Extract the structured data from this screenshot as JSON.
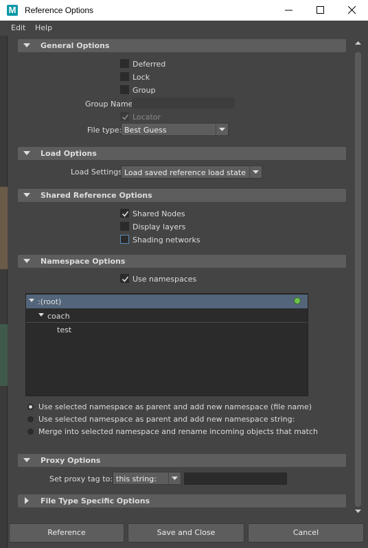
{
  "window": {
    "title": "Reference Options",
    "app_icon_letter": "M"
  },
  "menu": {
    "items": [
      "Edit",
      "Help"
    ]
  },
  "general": {
    "title": "General Options",
    "deferred": "Deferred",
    "lock": "Lock",
    "group": "Group",
    "group_name_label": "Group Name:",
    "group_name_value": "",
    "locator": "Locator",
    "file_type_label": "File type:",
    "file_type_value": "Best Guess"
  },
  "load": {
    "title": "Load Options",
    "settings_label": "Load Settings",
    "settings_value": "Load saved reference load state"
  },
  "shared": {
    "title": "Shared Reference Options",
    "shared_nodes": "Shared Nodes",
    "display_layers": "Display layers",
    "shading_networks": "Shading networks"
  },
  "namespace": {
    "title": "Namespace Options",
    "use_namespaces": "Use namespaces",
    "tree": {
      "root": ":(root)",
      "child": "coach",
      "grandchild": "test"
    },
    "radio1": "Use selected namespace as parent and add new namespace (file name)",
    "radio2": "Use selected namespace as parent and add new namespace string:",
    "radio3": "Merge into selected namespace and rename incoming objects that match"
  },
  "proxy": {
    "title": "Proxy Options",
    "tag_label": "Set proxy tag to:",
    "tag_mode": "this string:",
    "tag_value": ""
  },
  "filetype": {
    "title": "File Type Specific Options"
  },
  "buttons": {
    "reference": "Reference",
    "save_close": "Save and Close",
    "cancel": "Cancel"
  },
  "colors": {
    "panel": "#444444",
    "header": "#5d5d5d",
    "field": "#2b2b2b",
    "status_dot": "#6cc24a",
    "selection": "#52657a"
  }
}
